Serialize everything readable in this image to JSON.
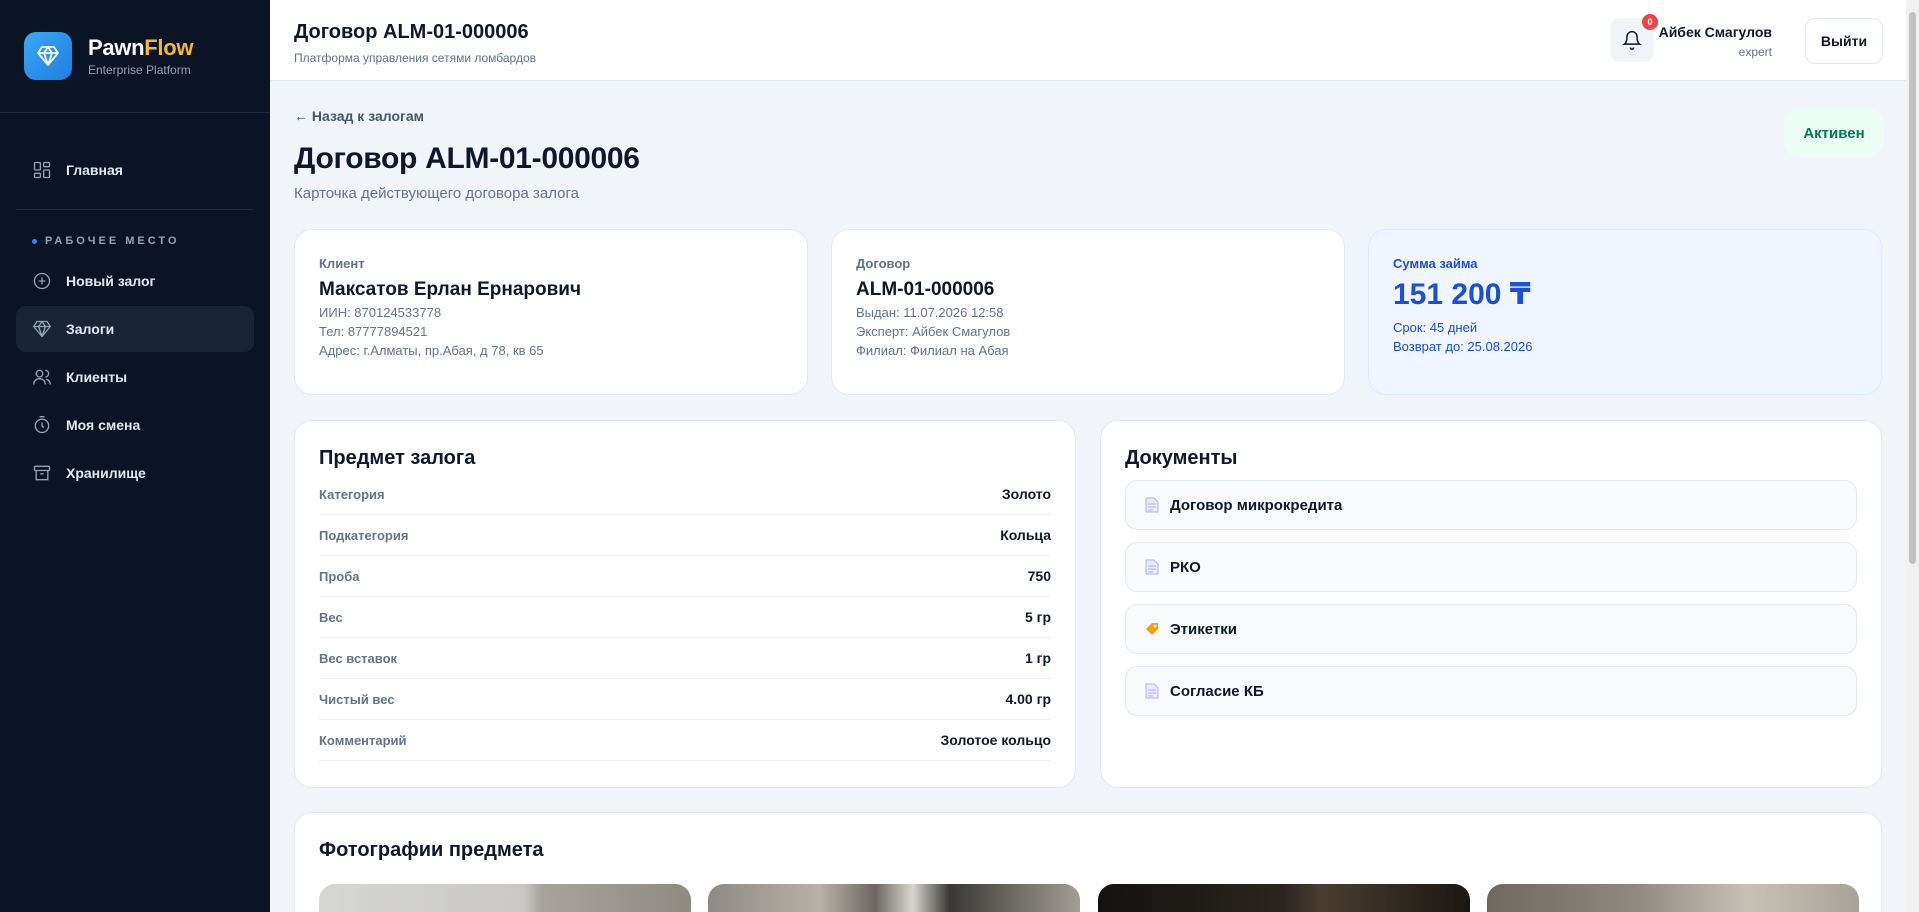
{
  "brand": {
    "name_part1": "Pawn",
    "name_part2": "Flow",
    "subtitle": "Enterprise Platform",
    "logo_icon": "diamond-icon"
  },
  "sidebar": {
    "home": {
      "label": "Главная",
      "icon": "grid-icon"
    },
    "section_label": "РАБОЧЕЕ МЕСТО",
    "items": [
      {
        "label": "Новый залог",
        "icon": "plus-circle-icon",
        "active": false
      },
      {
        "label": "Залоги",
        "icon": "diamond-icon",
        "active": true
      },
      {
        "label": "Клиенты",
        "icon": "users-icon",
        "active": false
      },
      {
        "label": "Моя смена",
        "icon": "timer-icon",
        "active": false
      },
      {
        "label": "Хранилище",
        "icon": "archive-icon",
        "active": false
      }
    ]
  },
  "header": {
    "title": "Договор ALM-01-000006",
    "subtitle": "Платформа управления сетями ломбардов",
    "notifications_count": "0",
    "user_name": "Айбек Смагулов",
    "user_role": "expert",
    "logout_label": "Выйти"
  },
  "page": {
    "back_link": "← Назад к залогам",
    "title": "Договор ALM-01-000006",
    "subtitle": "Карточка действующего договора залога",
    "status": "Активен"
  },
  "client_card": {
    "label": "Клиент",
    "name": "Максатов Ерлан Ернарович",
    "iin": "ИИН: 870124533778",
    "phone": "Тел: 87777894521",
    "address": "Адрес: г.Алматы, пр.Абая, д 78, кв 65"
  },
  "contract_card": {
    "label": "Договор",
    "number": "ALM-01-000006",
    "issued": "Выдан: 11.07.2026 12:58",
    "expert": "Эксперт: Айбек Смагулов",
    "branch": "Филиал: Филиал на Абая"
  },
  "loan_card": {
    "label": "Сумма займа",
    "amount": "151 200 ₸",
    "term": "Срок: 45 дней",
    "return_date": "Возврат до: 25.08.2026"
  },
  "collateral": {
    "title": "Предмет залога",
    "rows": [
      {
        "label": "Категория",
        "value": "Золото"
      },
      {
        "label": "Подкатегория",
        "value": "Кольца"
      },
      {
        "label": "Проба",
        "value": "750"
      },
      {
        "label": "Вес",
        "value": "5 гр"
      },
      {
        "label": "Вес вставок",
        "value": "1 гр"
      },
      {
        "label": "Чистый вес",
        "value": "4.00 гр"
      },
      {
        "label": "Комментарий",
        "value": "Золотое кольцо"
      }
    ]
  },
  "documents": {
    "title": "Документы",
    "items": [
      {
        "label": "Договор микрокредита",
        "icon": "document-icon"
      },
      {
        "label": "РКО",
        "icon": "document-icon"
      },
      {
        "label": "Этикетки",
        "icon": "tag-icon"
      },
      {
        "label": "Согласие КБ",
        "icon": "document-icon"
      }
    ]
  },
  "photos": {
    "title": "Фотографии предмета"
  }
}
